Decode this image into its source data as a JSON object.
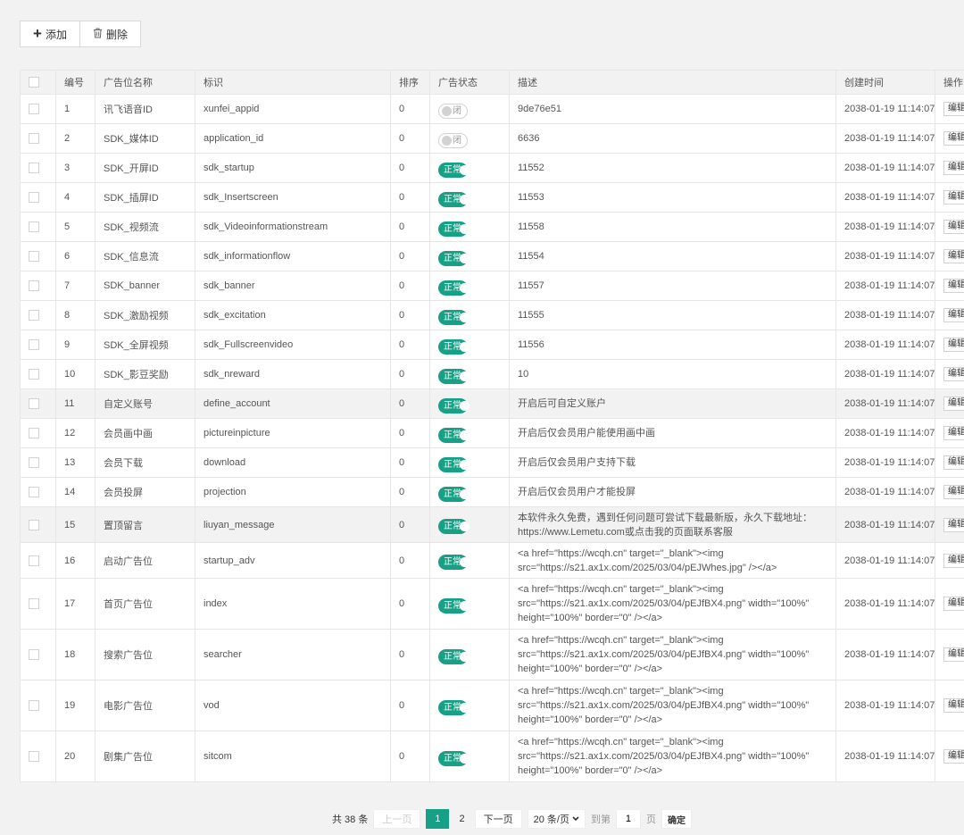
{
  "toolbar": {
    "add_label": "添加",
    "delete_label": "删除",
    "add_icon": "plus-icon",
    "delete_icon": "trash-icon"
  },
  "table": {
    "headers": [
      "编号",
      "广告位名称",
      "标识",
      "排序",
      "广告状态",
      "描述",
      "创建时间",
      "操作"
    ],
    "edit_label": "编辑",
    "rows": [
      {
        "id": "1",
        "name": "讯飞语音ID",
        "key": "xunfei_appid",
        "sort": "0",
        "status": "闭",
        "on": false,
        "desc": "9de76e51",
        "time": "2038-01-19 11:14:07"
      },
      {
        "id": "2",
        "name": "SDK_媒体ID",
        "key": "application_id",
        "sort": "0",
        "status": "闭",
        "on": false,
        "desc": "6636",
        "time": "2038-01-19 11:14:07"
      },
      {
        "id": "3",
        "name": "SDK_开屏ID",
        "key": "sdk_startup",
        "sort": "0",
        "status": "正常",
        "on": true,
        "desc": "11552",
        "time": "2038-01-19 11:14:07"
      },
      {
        "id": "4",
        "name": "SDK_插屏ID",
        "key": "sdk_Insertscreen",
        "sort": "0",
        "status": "正常",
        "on": true,
        "desc": "11553",
        "time": "2038-01-19 11:14:07"
      },
      {
        "id": "5",
        "name": "SDK_视频流",
        "key": "sdk_Videoinformationstream",
        "sort": "0",
        "status": "正常",
        "on": true,
        "desc": "11558",
        "time": "2038-01-19 11:14:07"
      },
      {
        "id": "6",
        "name": "SDK_信息流",
        "key": "sdk_informationflow",
        "sort": "0",
        "status": "正常",
        "on": true,
        "desc": "11554",
        "time": "2038-01-19 11:14:07"
      },
      {
        "id": "7",
        "name": "SDK_banner",
        "key": "sdk_banner",
        "sort": "0",
        "status": "正常",
        "on": true,
        "desc": "11557",
        "time": "2038-01-19 11:14:07"
      },
      {
        "id": "8",
        "name": "SDK_激励视频",
        "key": "sdk_excitation",
        "sort": "0",
        "status": "正常",
        "on": true,
        "desc": "11555",
        "time": "2038-01-19 11:14:07"
      },
      {
        "id": "9",
        "name": "SDK_全屏视频",
        "key": "sdk_Fullscreenvideo",
        "sort": "0",
        "status": "正常",
        "on": true,
        "desc": "11556",
        "time": "2038-01-19 11:14:07"
      },
      {
        "id": "10",
        "name": "SDK_影豆奖励",
        "key": "sdk_nreward",
        "sort": "0",
        "status": "正常",
        "on": true,
        "desc": "10",
        "time": "2038-01-19 11:14:07"
      },
      {
        "id": "11",
        "name": "自定义账号",
        "key": "define_account",
        "sort": "0",
        "status": "正常",
        "on": true,
        "desc": "开启后可自定义账户",
        "time": "2038-01-19 11:14:07"
      },
      {
        "id": "12",
        "name": "会员画中画",
        "key": "pictureinpicture",
        "sort": "0",
        "status": "正常",
        "on": true,
        "desc": "开启后仅会员用户能使用画中画",
        "time": "2038-01-19 11:14:07"
      },
      {
        "id": "13",
        "name": "会员下载",
        "key": "download",
        "sort": "0",
        "status": "正常",
        "on": true,
        "desc": "开启后仅会员用户支持下载",
        "time": "2038-01-19 11:14:07"
      },
      {
        "id": "14",
        "name": "会员投屏",
        "key": "projection",
        "sort": "0",
        "status": "正常",
        "on": true,
        "desc": "开启后仅会员用户才能投屏",
        "time": "2038-01-19 11:14:07"
      },
      {
        "id": "15",
        "name": "置顶留言",
        "key": "liuyan_message",
        "sort": "0",
        "status": "正常",
        "on": true,
        "desc": "本软件永久免费，遇到任何问题可尝试下载最新版，永久下载地址：https://www.Lemetu.com或点击我的页面联系客服",
        "time": "2038-01-19 11:14:07"
      },
      {
        "id": "16",
        "name": "启动广告位",
        "key": "startup_adv",
        "sort": "0",
        "status": "正常",
        "on": true,
        "desc": "<a href=\"https://wcqh.cn\" target=\"_blank\"><img src=\"https://s21.ax1x.com/2025/03/04/pEJWhes.jpg\" /></a>",
        "time": "2038-01-19 11:14:07"
      },
      {
        "id": "17",
        "name": "首页广告位",
        "key": "index",
        "sort": "0",
        "status": "正常",
        "on": true,
        "desc": "<a href=\"https://wcqh.cn\" target=\"_blank\"><img src=\"https://s21.ax1x.com/2025/03/04/pEJfBX4.png\" width=\"100%\" height=\"100%\" border=\"0\" /></a>",
        "time": "2038-01-19 11:14:07"
      },
      {
        "id": "18",
        "name": "搜索广告位",
        "key": "searcher",
        "sort": "0",
        "status": "正常",
        "on": true,
        "desc": "<a href=\"https://wcqh.cn\" target=\"_blank\"><img src=\"https://s21.ax1x.com/2025/03/04/pEJfBX4.png\" width=\"100%\" height=\"100%\" border=\"0\" /></a>",
        "time": "2038-01-19 11:14:07"
      },
      {
        "id": "19",
        "name": "电影广告位",
        "key": "vod",
        "sort": "0",
        "status": "正常",
        "on": true,
        "desc": "<a href=\"https://wcqh.cn\" target=\"_blank\"><img src=\"https://s21.ax1x.com/2025/03/04/pEJfBX4.png\" width=\"100%\" height=\"100%\" border=\"0\" /></a>",
        "time": "2038-01-19 11:14:07"
      },
      {
        "id": "20",
        "name": "剧集广告位",
        "key": "sitcom",
        "sort": "0",
        "status": "正常",
        "on": true,
        "desc": "<a href=\"https://wcqh.cn\" target=\"_blank\"><img src=\"https://s21.ax1x.com/2025/03/04/pEJfBX4.png\" width=\"100%\" height=\"100%\" border=\"0\" /></a>",
        "time": "2038-01-19 11:14:07"
      }
    ]
  },
  "pagination": {
    "total": "共 38 条",
    "prev": "上一页",
    "pages": [
      "1",
      "2"
    ],
    "current": "1",
    "next": "下一页",
    "page_size": "20 条/页",
    "goto_label": "到第",
    "goto_value": "1",
    "page_unit": "页",
    "confirm": "确定"
  },
  "colors": {
    "accent": "#16a085"
  }
}
